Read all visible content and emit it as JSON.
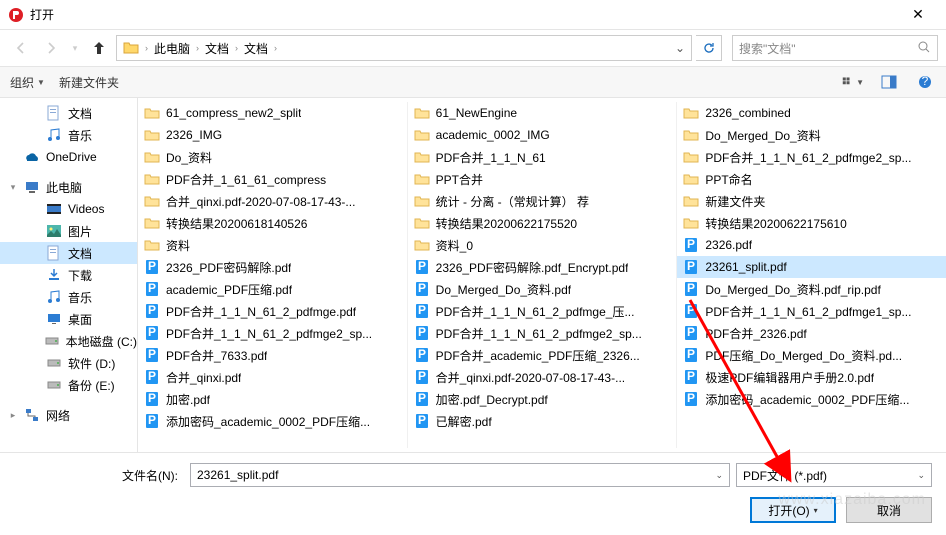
{
  "window": {
    "title": "打开",
    "close": "✕"
  },
  "nav": {
    "path": [
      "此电脑",
      "文档",
      "文档"
    ],
    "search_placeholder": "搜索\"文档\""
  },
  "toolbar": {
    "organize": "组织",
    "newfolder": "新建文件夹"
  },
  "sidebar": {
    "items": [
      {
        "label": "文档",
        "icon": "doc",
        "indent": 1
      },
      {
        "label": "音乐",
        "icon": "music",
        "indent": 1
      },
      {
        "label": "OneDrive",
        "icon": "onedrive",
        "indent": 0,
        "exp": ""
      },
      {
        "label": "此电脑",
        "icon": "pc",
        "indent": 0,
        "exp": "▾"
      },
      {
        "label": "Videos",
        "icon": "video",
        "indent": 1
      },
      {
        "label": "图片",
        "icon": "pic",
        "indent": 1
      },
      {
        "label": "文档",
        "icon": "doc",
        "indent": 1,
        "selected": true
      },
      {
        "label": "下载",
        "icon": "download",
        "indent": 1
      },
      {
        "label": "音乐",
        "icon": "music",
        "indent": 1
      },
      {
        "label": "桌面",
        "icon": "desktop",
        "indent": 1
      },
      {
        "label": "本地磁盘 (C:)",
        "icon": "disk",
        "indent": 1
      },
      {
        "label": "软件 (D:)",
        "icon": "disk",
        "indent": 1
      },
      {
        "label": "备份 (E:)",
        "icon": "disk",
        "indent": 1
      },
      {
        "label": "网络",
        "icon": "network",
        "indent": 0,
        "exp": "▸"
      }
    ]
  },
  "files": {
    "col1": [
      {
        "t": "folder",
        "n": "61_compress_new2_split"
      },
      {
        "t": "folder",
        "n": "2326_IMG"
      },
      {
        "t": "folder",
        "n": "Do_资料"
      },
      {
        "t": "folder",
        "n": "PDF合并_1_61_61_compress"
      },
      {
        "t": "folder",
        "n": "合并_qinxi.pdf-2020-07-08-17-43-..."
      },
      {
        "t": "folder",
        "n": "转换结果20200618140526"
      },
      {
        "t": "folder",
        "n": "资料"
      },
      {
        "t": "pdf",
        "n": "2326_PDF密码解除.pdf"
      },
      {
        "t": "pdf",
        "n": "academic_PDF压缩.pdf"
      },
      {
        "t": "pdf",
        "n": "PDF合并_1_1_N_61_2_pdfmge.pdf"
      },
      {
        "t": "pdf",
        "n": "PDF合并_1_1_N_61_2_pdfmge2_sp..."
      },
      {
        "t": "pdf",
        "n": "PDF合并_7633.pdf"
      },
      {
        "t": "pdf",
        "n": "合并_qinxi.pdf"
      },
      {
        "t": "pdf",
        "n": "加密.pdf"
      },
      {
        "t": "pdf",
        "n": "添加密码_academic_0002_PDF压缩..."
      }
    ],
    "col2": [
      {
        "t": "folder",
        "n": "61_NewEngine"
      },
      {
        "t": "folder",
        "n": "academic_0002_IMG"
      },
      {
        "t": "folder",
        "n": "PDF合并_1_1_N_61"
      },
      {
        "t": "folder",
        "n": "PPT合并"
      },
      {
        "t": "folder",
        "n": "统计 - 分离 -（常规计算） 荐"
      },
      {
        "t": "folder",
        "n": "转换结果20200622175520"
      },
      {
        "t": "folder",
        "n": "资料_0"
      },
      {
        "t": "pdf",
        "n": "2326_PDF密码解除.pdf_Encrypt.pdf"
      },
      {
        "t": "pdf",
        "n": "Do_Merged_Do_资料.pdf"
      },
      {
        "t": "pdf",
        "n": "PDF合并_1_1_N_61_2_pdfmge_压..."
      },
      {
        "t": "pdf",
        "n": "PDF合并_1_1_N_61_2_pdfmge2_sp..."
      },
      {
        "t": "pdf",
        "n": "PDF合并_academic_PDF压缩_2326..."
      },
      {
        "t": "pdf",
        "n": "合并_qinxi.pdf-2020-07-08-17-43-..."
      },
      {
        "t": "pdf",
        "n": "加密.pdf_Decrypt.pdf"
      },
      {
        "t": "pdf",
        "n": "已解密.pdf"
      }
    ],
    "col3": [
      {
        "t": "folder",
        "n": "2326_combined"
      },
      {
        "t": "folder",
        "n": "Do_Merged_Do_资料"
      },
      {
        "t": "folder",
        "n": "PDF合并_1_1_N_61_2_pdfmge2_sp..."
      },
      {
        "t": "folder",
        "n": "PPT命名"
      },
      {
        "t": "folder",
        "n": "新建文件夹"
      },
      {
        "t": "folder",
        "n": "转换结果20200622175610"
      },
      {
        "t": "pdf",
        "n": "2326.pdf"
      },
      {
        "t": "pdf",
        "n": "23261_split.pdf",
        "selected": true
      },
      {
        "t": "pdf",
        "n": "Do_Merged_Do_资料.pdf_rip.pdf"
      },
      {
        "t": "pdf",
        "n": "PDF合并_1_1_N_61_2_pdfmge1_sp..."
      },
      {
        "t": "pdf",
        "n": "PDF合并_2326.pdf"
      },
      {
        "t": "pdf",
        "n": "PDF压缩_Do_Merged_Do_资料.pd..."
      },
      {
        "t": "pdf",
        "n": "极速PDF编辑器用户手册2.0.pdf"
      },
      {
        "t": "pdf",
        "n": "添加密码_academic_0002_PDF压缩..."
      }
    ]
  },
  "bottom": {
    "filename_label": "文件名(N):",
    "filename_value": "23261_split.pdf",
    "filter": "PDF文件 (*.pdf)",
    "open": "打开(O)",
    "cancel": "取消"
  },
  "watermark": "www.xiazaiba.com"
}
